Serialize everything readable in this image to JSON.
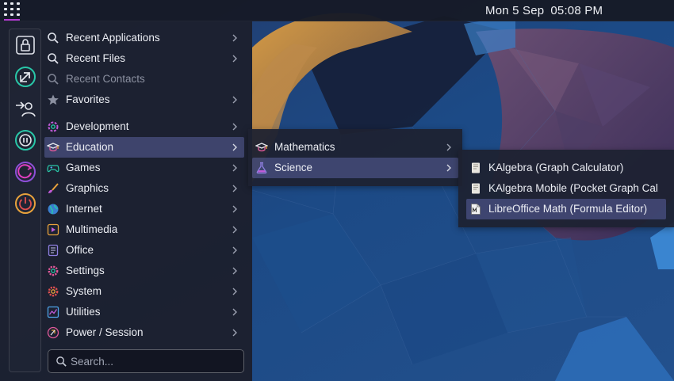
{
  "panel": {
    "clock_date": "Mon 5 Sep",
    "clock_time": "05:08 PM",
    "launcher_icon": "app-grid-icon"
  },
  "sidebar": {
    "buttons": [
      {
        "name": "lock-screen-icon"
      },
      {
        "name": "leave-icon"
      },
      {
        "name": "switch-user-icon"
      },
      {
        "name": "suspend-icon"
      },
      {
        "name": "restart-icon"
      },
      {
        "name": "shutdown-icon"
      }
    ]
  },
  "menu": {
    "top_items": [
      {
        "label": "Recent Applications",
        "icon": "search-icon"
      },
      {
        "label": "Recent Files",
        "icon": "search-icon"
      },
      {
        "label": "Recent Contacts",
        "icon": "search-icon",
        "disabled": true
      },
      {
        "label": "Favorites",
        "icon": "star-icon"
      }
    ],
    "categories": [
      {
        "label": "Development",
        "icon": "development-icon"
      },
      {
        "label": "Education",
        "icon": "education-icon",
        "selected": true
      },
      {
        "label": "Games",
        "icon": "gamepad-icon"
      },
      {
        "label": "Graphics",
        "icon": "brush-icon"
      },
      {
        "label": "Internet",
        "icon": "globe-icon"
      },
      {
        "label": "Multimedia",
        "icon": "play-icon"
      },
      {
        "label": "Office",
        "icon": "document-icon"
      },
      {
        "label": "Settings",
        "icon": "gear-icon"
      },
      {
        "label": "System",
        "icon": "gear-icon"
      },
      {
        "label": "Utilities",
        "icon": "chart-icon"
      },
      {
        "label": "Power / Session",
        "icon": "session-icon"
      }
    ],
    "search_placeholder": "Search..."
  },
  "education_submenu": {
    "items": [
      {
        "label": "Mathematics",
        "icon": "education-icon"
      },
      {
        "label": "Science",
        "icon": "flask-icon",
        "selected": true
      }
    ]
  },
  "science_submenu": {
    "items": [
      {
        "label": "KAlgebra (Graph Calculator)",
        "icon": "kalgebra-icon"
      },
      {
        "label": "KAlgebra Mobile (Pocket Graph Cal",
        "icon": "kalgebra-icon"
      },
      {
        "label": "LibreOffice Math (Formula Editor)",
        "icon": "libreoffice-math-icon",
        "hovered": true
      }
    ]
  },
  "colors": {
    "accent": "#b23ad1",
    "selection": "#5a5fa8",
    "panel_bg": "#1c202e"
  }
}
